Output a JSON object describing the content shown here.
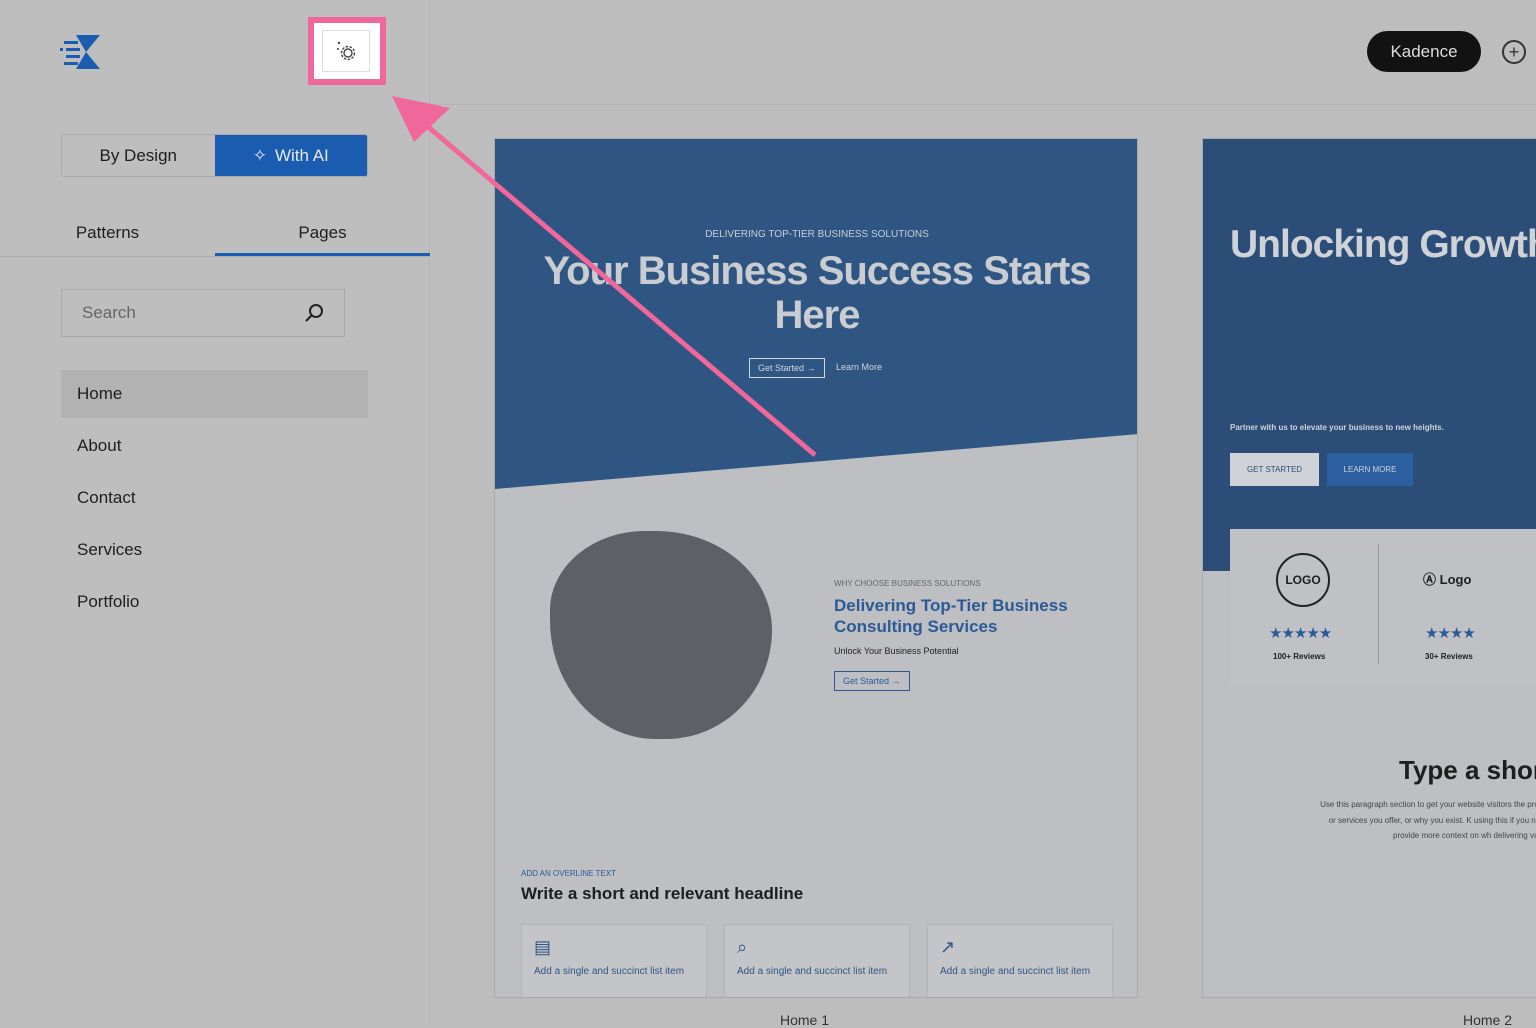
{
  "sidebar": {
    "mode_tabs": [
      "By Design",
      "With AI"
    ],
    "tabs": [
      "Patterns",
      "Pages"
    ],
    "search_placeholder": "Search",
    "pages": [
      "Home",
      "About",
      "Contact",
      "Services",
      "Portfolio"
    ]
  },
  "header": {
    "kit_button": "Kadence"
  },
  "accent": "#1a5cb0",
  "highlight": "#f0679b",
  "previews": [
    {
      "name": "Home 1",
      "overline": "DELIVERING TOP-TIER BUSINESS SOLUTIONS",
      "headline": "Your Business Success Starts Here",
      "btn1": "Get Started →",
      "btn2": "Learn More",
      "sec_overline": "WHY CHOOSE BUSINESS SOLUTIONS",
      "sec_title": "Delivering Top-Tier Business Consulting Services",
      "sec_sub": "Unlock Your Business Potential",
      "sec_btn": "Get Started →",
      "list_overline": "ADD AN OVERLINE TEXT",
      "list_title": "Write a short and relevant headline",
      "list_items": [
        "Add a single and succinct list item",
        "Add a single and succinct list item",
        "Add a single and succinct list item"
      ]
    },
    {
      "name": "Home 2",
      "headline": "Unlocking Growth Potential Through Expert Business Consulting",
      "sub": "Partner with us to elevate your business to new heights.",
      "btn1": "GET STARTED",
      "btn2": "LEARN MORE",
      "logos": [
        {
          "logo": "LOGO",
          "stars": 5,
          "reviews": "100+ Reviews"
        },
        {
          "logo": "Logo",
          "stars": 4,
          "reviews": "30+ Reviews"
        }
      ],
      "section_title": "Type a short",
      "section_text": "Use this paragraph section to get your website visitors the products or services you offer, or why you exist. K using this if you need to provide more context on wh delivering value to"
    }
  ]
}
